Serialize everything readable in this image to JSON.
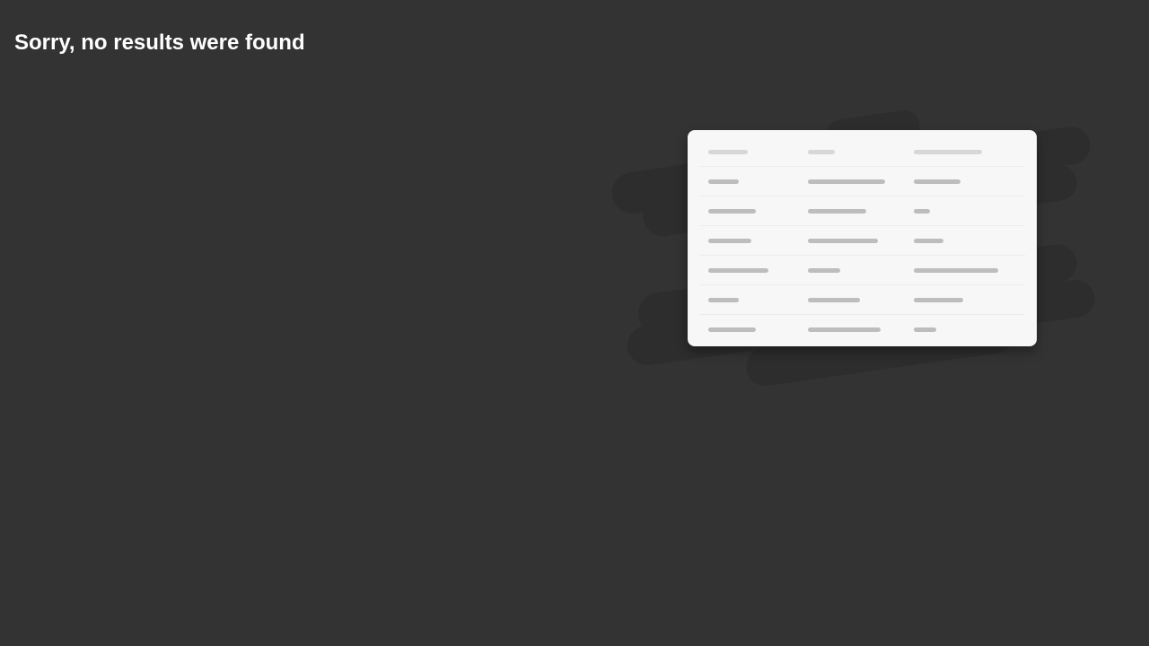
{
  "message": {
    "title": "Sorry, no results were found"
  },
  "illustration": {
    "icon": "empty-table-illustration",
    "colors": {
      "background": "#333333",
      "blob": "#2d2d2d",
      "card": "#f7f7f7",
      "header_bar": "#d7d7d7",
      "row_bar": "#bdbdbd",
      "divider": "#ececec"
    },
    "header_bar_fractions": [
      0.42,
      0.27,
      0.69
    ],
    "rows": [
      [
        0.32,
        0.78,
        0.47
      ],
      [
        0.5,
        0.59,
        0.16
      ],
      [
        0.46,
        0.71,
        0.3
      ],
      [
        0.64,
        0.33,
        0.85
      ],
      [
        0.32,
        0.53,
        0.5
      ],
      [
        0.5,
        0.74,
        0.23
      ]
    ]
  }
}
